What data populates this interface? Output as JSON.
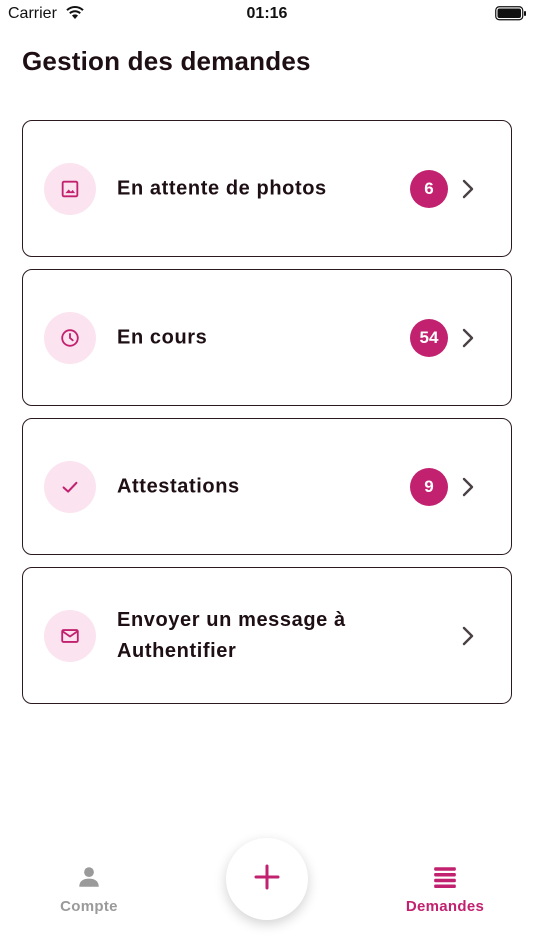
{
  "status_bar": {
    "carrier": "Carrier",
    "time": "01:16"
  },
  "page": {
    "title": "Gestion des demandes"
  },
  "colors": {
    "accent": "#c2216f",
    "icon_bg": "#fbe4ef",
    "text": "#1d0f14",
    "inactive": "#9a9a9a"
  },
  "items": [
    {
      "label": "En attente de photos",
      "count": "6",
      "icon": "image-icon"
    },
    {
      "label": "En cours",
      "count": "54",
      "icon": "clock-icon"
    },
    {
      "label": "Attestations",
      "count": "9",
      "icon": "check-icon"
    },
    {
      "label": "Envoyer un message à Authentifier",
      "count": "",
      "icon": "mail-icon"
    }
  ],
  "tabs": [
    {
      "label": "Compte",
      "icon": "person-icon",
      "active": false
    },
    {
      "label": "Demandes",
      "icon": "list-icon",
      "active": true
    }
  ],
  "fab": {
    "icon": "plus-icon"
  }
}
